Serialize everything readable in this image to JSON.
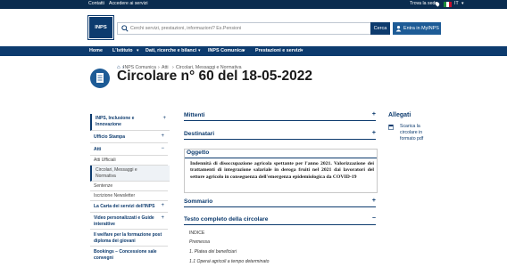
{
  "topbar": {
    "contacts": "Contatti",
    "services": "Accedere ai servizi",
    "find_office": "Trova la sede",
    "language": "IT"
  },
  "header": {
    "logo_text": "INPS",
    "search_placeholder": "Cerchi servizi, prestazioni, informazioni? Es.Pensioni",
    "search_button": "Cerca",
    "mypage_button": "Entra in MyINPS"
  },
  "nav": {
    "items": [
      "Home",
      "L'Istituto",
      "Dati, ricerche e bilanci",
      "INPS Comunica",
      "Prestazioni e servizi"
    ]
  },
  "breadcrumb": [
    "INPS Comunica",
    "Atti",
    "Circolari, Messaggi e Normativa"
  ],
  "page_title": "Circolare n° 60 del 18-05-2022",
  "sidebar": {
    "items": [
      {
        "label": "INPS, Inclusione e Innovazione",
        "toggle": "+"
      },
      {
        "label": "Ufficio Stampa",
        "toggle": "+"
      },
      {
        "label": "Atti",
        "toggle": "−"
      },
      {
        "label": "Atti Ufficiali"
      },
      {
        "label": "Circolari, Messaggi e Normativa"
      },
      {
        "label": "Sentenze"
      },
      {
        "label": "Iscrizione Newsletter"
      },
      {
        "label": "La Carta dei servizi dell'INPS",
        "toggle": "+"
      },
      {
        "label": "Video personalizzati e Guide interattive",
        "toggle": "+"
      },
      {
        "label": "Il welfare per la formazione post diploma dei giovani"
      },
      {
        "label": "Bookings – Concessione sale convegni"
      }
    ]
  },
  "main": {
    "sections": [
      {
        "label": "Mittenti",
        "toggle": "+"
      },
      {
        "label": "Destinatari",
        "toggle": "+"
      }
    ],
    "oggetto_label": "Oggetto",
    "oggetto_text": "Indennità di disoccupazione agricola spettante per l'anno 2021. Valorizzazione dei trattamenti di integrazione salariale in deroga fruiti nel 2021 dai lavoratori del settore agricolo in conseguenza dell'emergenza epidemiologica da COVID-19",
    "sommario_label": "Sommario",
    "sommario_toggle": "+",
    "testo_label": "Testo completo della circolare",
    "testo_toggle": "−",
    "toc": [
      "INDICE",
      "Premessa",
      "1. Platea dei beneficiari",
      "1.1 Operai agricoli a tempo determinato"
    ]
  },
  "allegati": {
    "title": "Allegati",
    "item": "Scarica la circolare in formato pdf"
  },
  "colors": {
    "brand": "#0d3b6e",
    "topbar": "#0a2c4f",
    "accent": "#1d5b96"
  }
}
